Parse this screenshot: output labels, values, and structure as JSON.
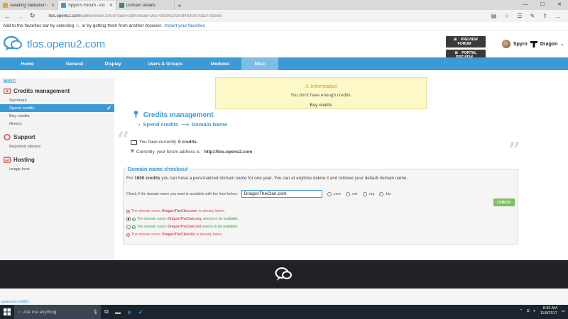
{
  "browser": {
    "tabs": [
      {
        "title": "Awaiting Validation - ARK -",
        "icon_color": "#e8a33b",
        "active": false
      },
      {
        "title": "Spyro's Forum - Po",
        "icon_color": "#3c9ad6",
        "active": true
      },
      {
        "title": "Domain Details",
        "icon_color": "#3a8a6a",
        "active": false
      }
    ],
    "url_host": "tlos.openu2.com",
    "url_path": "/admin/index.forum?part=admin&tid=16370d39e20359f483f307da2f7cb59e",
    "fav_text": "Add to the favorites bar by selecting ☆, or by getting them from another browser.",
    "fav_link": "Import your favorites"
  },
  "header": {
    "site_name": "tlos.openu2.com",
    "preview_forum": "PREVIEW FORUM",
    "portal_preview": "PORTAL PREVIEW",
    "username": "Spyro",
    "username_suffix": "Dragon"
  },
  "nav": [
    "Home",
    "General",
    "Display",
    "Users & Groups",
    "Modules",
    "Misc"
  ],
  "sidebar": {
    "heading": "MISC",
    "sections": [
      {
        "title": "Credits management",
        "items": [
          "Summary",
          "Spend credits",
          "Buy credits",
          "History"
        ]
      },
      {
        "title": "Support",
        "items": [
          "Reported abuses"
        ]
      },
      {
        "title": "Hosting",
        "items": [
          "Image host"
        ]
      }
    ]
  },
  "info": {
    "title": "Information",
    "message": "You don't have enough credits.",
    "button": "Buy credits"
  },
  "page": {
    "title": "Credits management",
    "crumb1": "Spend credits",
    "crumb2": "Domain Name",
    "credits_prefix": "You have currently",
    "credits_value": "0 credits.",
    "address_prefix": "Currently, your forum address is :",
    "address_value": "http://tlos.openu2.com"
  },
  "checkout": {
    "title": "Domain name checkout",
    "intro_prefix": "For",
    "intro_amount": "1600 credits",
    "intro_suffix": "you can have a personalized domain name for one year. You can at anytime delete it and retrieve your default domain name.",
    "check_label": "Check if the domain name you want is available with the form below :",
    "input_value": "DragonTheClan.com",
    "tlds": [
      ".com",
      ".net",
      ".org",
      ".biz"
    ],
    "check_button": "CHECK",
    "results": [
      {
        "prefix": "The domain name",
        "domain": "DragonTheClan.com",
        "suffix": "is already taken.",
        "ok": false
      },
      {
        "prefix": "The domain name",
        "domain": "DragonTheClan.org",
        "suffix": "seems to be available.",
        "ok": true
      },
      {
        "prefix": "The domain name",
        "domain": "DragonTheClan.net",
        "suffix": "seems to be available.",
        "ok": true
      },
      {
        "prefix": "The domain name",
        "domain": "DragonTheClan.biz",
        "suffix": "is already taken.",
        "ok": false
      }
    ]
  },
  "status_text": "javascript:void(0);",
  "taskbar": {
    "search_placeholder": "Ask me anything",
    "time": "8:36 AM",
    "date": "11/8/2017"
  }
}
